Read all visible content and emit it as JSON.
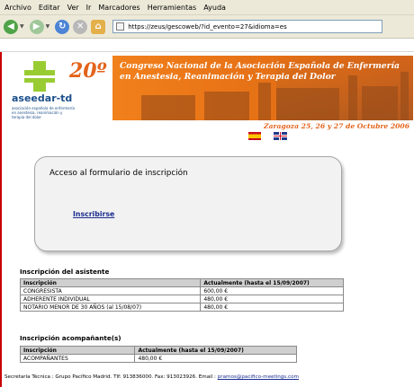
{
  "browser": {
    "menu": [
      "Archivo",
      "Editar",
      "Ver",
      "Ir",
      "Marcadores",
      "Herramientas",
      "Ayuda"
    ],
    "address": "https://zeus/gescoweb/?id_evento=27&idioma=es"
  },
  "banner": {
    "edition": "20º",
    "title_line1": "Congreso Nacional de la Asociación Española de Enfermería",
    "title_line2": "en Anestesia, Reanimación y  Terapia del Dolor",
    "logo_text": "aseedar-td",
    "logo_tagline_1": "asociación española de enfermería",
    "logo_tagline_2": "en anestesia, reanimación y",
    "logo_tagline_3": "terapia del dolor",
    "location_date": "Zaragoza 25, 26 y 27 de Octubre 2006"
  },
  "languages": [
    {
      "name": "spanish-flag-icon"
    },
    {
      "name": "uk-flag-icon"
    }
  ],
  "access": {
    "title": "Acceso al formulario de inscripción",
    "link": "Inscribirse"
  },
  "attendee": {
    "title": "Inscripción del asistente",
    "headers": [
      "Inscripción",
      "Actualmente (hasta el 15/09/2007)"
    ],
    "rows": [
      [
        "CONGRESISTA",
        "600,00 €"
      ],
      [
        "ADHERENTE INDIVIDUAL",
        "480,00 €"
      ],
      [
        "NOTARIO MENOR DE 30 AÑOS (al 15/08/07)",
        "480,00 €"
      ]
    ]
  },
  "companion": {
    "title": "Inscripción acompañante(s)",
    "headers": [
      "Inscripción",
      "Actualmente (hasta el 15/09/2007)"
    ],
    "rows": [
      [
        "ACOMPAÑANTES",
        "480,00 €"
      ]
    ]
  },
  "footer": {
    "text": "Secretaría Técnica : Grupo Pacífico Madrid. Tlf: 913836000. Fax: 913023926. Email : ",
    "email": "pramos@pacifico-meetings.com"
  },
  "colors": {
    "banner_orange": "#f07e1a",
    "accent_green": "#99cc33",
    "link_blue": "#1a2d8f",
    "page_border_red": "#c80000"
  }
}
